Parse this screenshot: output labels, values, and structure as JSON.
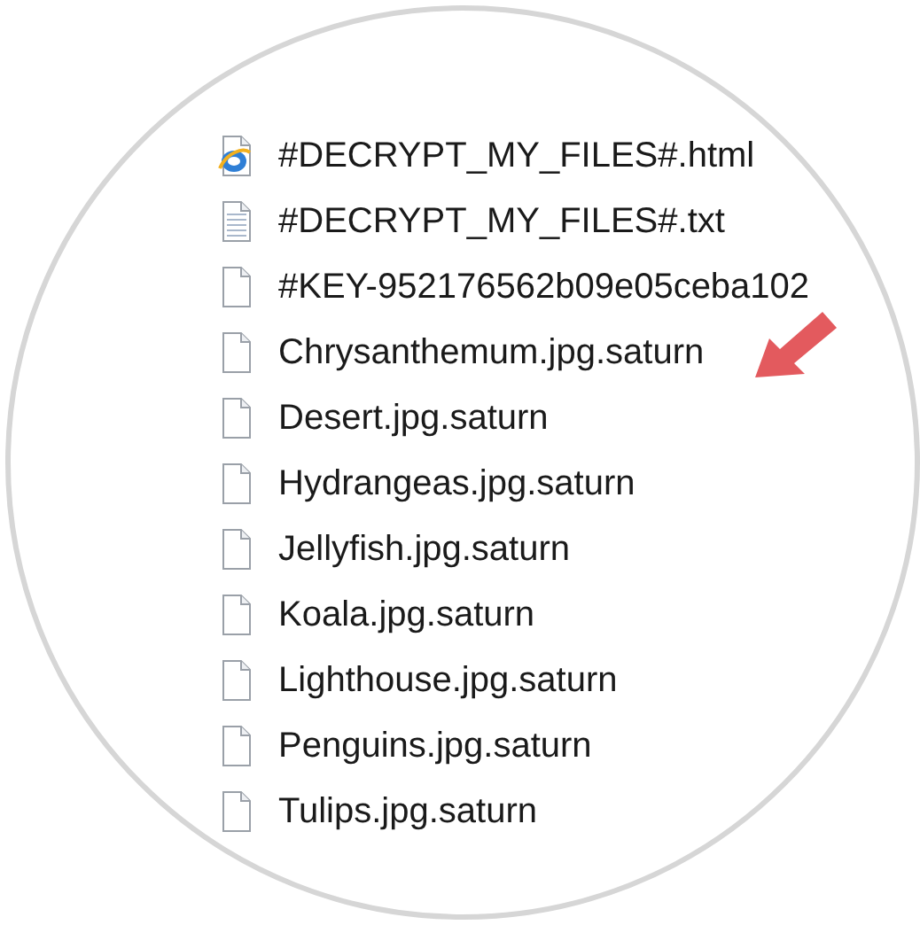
{
  "files": [
    {
      "name": "#DECRYPT_MY_FILES#.html",
      "kind": "html"
    },
    {
      "name": "#DECRYPT_MY_FILES#.txt",
      "kind": "text"
    },
    {
      "name": "#KEY-952176562b09e05ceba102",
      "kind": "blank"
    },
    {
      "name": "Chrysanthemum.jpg.saturn",
      "kind": "blank"
    },
    {
      "name": "Desert.jpg.saturn",
      "kind": "blank"
    },
    {
      "name": "Hydrangeas.jpg.saturn",
      "kind": "blank"
    },
    {
      "name": "Jellyfish.jpg.saturn",
      "kind": "blank"
    },
    {
      "name": "Koala.jpg.saturn",
      "kind": "blank"
    },
    {
      "name": "Lighthouse.jpg.saturn",
      "kind": "blank"
    },
    {
      "name": "Penguins.jpg.saturn",
      "kind": "blank"
    },
    {
      "name": "Tulips.jpg.saturn",
      "kind": "blank"
    }
  ]
}
